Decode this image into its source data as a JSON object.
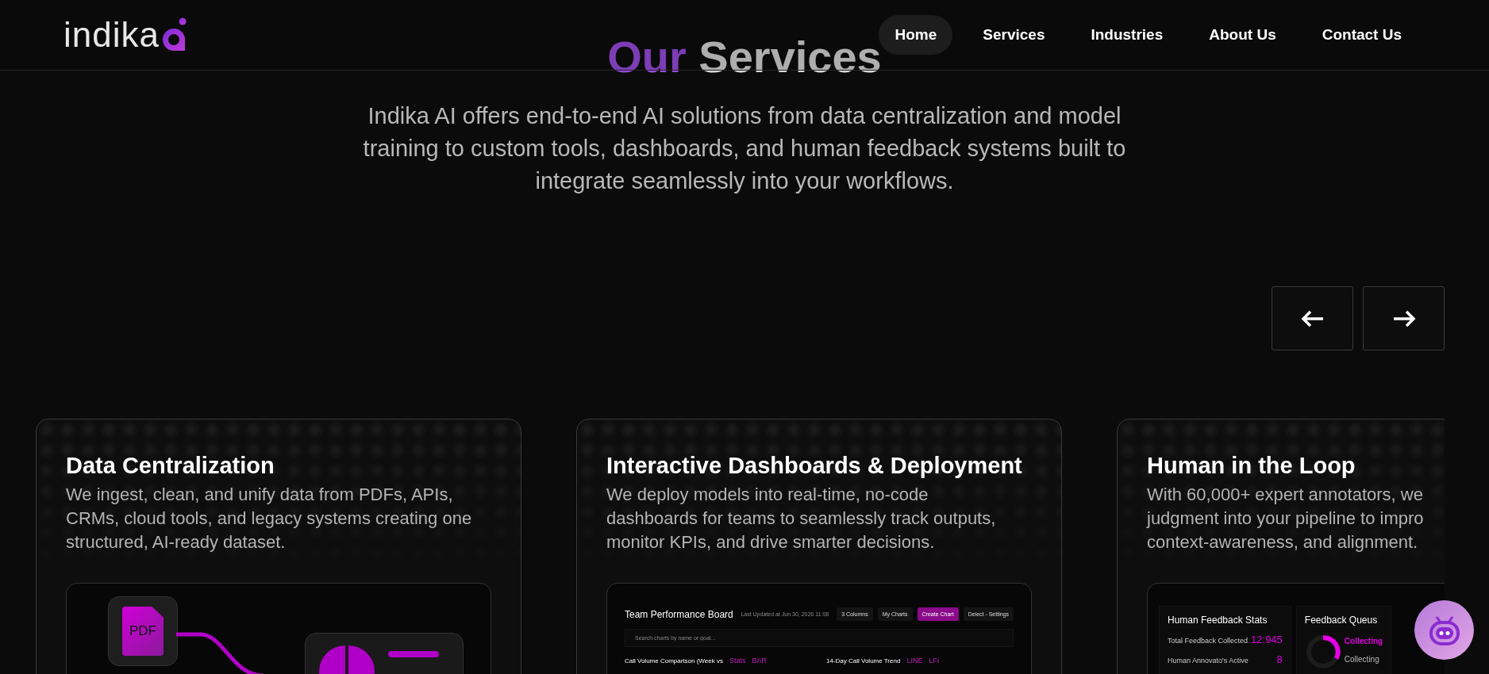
{
  "header": {
    "logo": "indika",
    "nav": [
      {
        "label": "Home",
        "selected": true
      },
      {
        "label": "Services",
        "selected": false
      },
      {
        "label": "Industries",
        "selected": false
      },
      {
        "label": "About Us",
        "selected": false
      },
      {
        "label": "Contact Us",
        "selected": false
      }
    ]
  },
  "hero": {
    "title_accent": "Our",
    "title": "Services",
    "intro": "Indika AI offers end-to-end AI solutions from data centralization and model training to custom tools, dashboards, and human feedback systems built to integrate seamlessly into your workflows."
  },
  "cards": [
    {
      "kind": "sources",
      "title": "Data Centralization",
      "lines": [
        "We ingest, clean, and unify data from PDFs, APIs,",
        "CRMs, cloud tools, and legacy systems creating one",
        "structured, AI-ready dataset."
      ],
      "visual": {
        "file_label": "PDF"
      }
    },
    {
      "kind": "dashboard",
      "title": "Interactive Dashboards & Deployment",
      "lines": [
        "We deploy models into real-time, no-code",
        "dashboards for teams to seamlessly track outputs,",
        "monitor KPIs, and drive smarter decisions."
      ],
      "visual": {
        "board_title": "Team Performance Board",
        "updated": "Last Updated at Jun 30, 2026 11:08",
        "columns_button": "3 Columns",
        "charts_button": "My Charts",
        "create_button": "Create Chart",
        "settings_button": "Delect - Settings",
        "search": {
          "placeholder": "Search charts by name or goal..."
        },
        "panels": [
          {
            "title": "Call Volume Compartson (Week vs",
            "tags": [
              "Stats",
              "BAR"
            ]
          },
          {
            "title": "14-Day Call Volume Trend",
            "tags": [
              "LINE",
              "LFi"
            ]
          }
        ]
      }
    },
    {
      "kind": "feedback",
      "title": "Human in the Loop",
      "lines": [
        "With 60,000+ expert annotators, we",
        "judgment into your pipeline to impro",
        "context-awareness, and alignment."
      ],
      "visual": {
        "stats_title": "Human Feedback Stats",
        "stats": [
          {
            "label": "Total Feedback Collected",
            "value": "12:945"
          },
          {
            "label": "Human Annovato's Active",
            "value": "8"
          }
        ],
        "queue_title": "Feedback Queus",
        "queue": [
          {
            "label": "Collecting",
            "selected": true
          },
          {
            "label": "Collecting",
            "selected": false
          }
        ]
      }
    }
  ]
}
